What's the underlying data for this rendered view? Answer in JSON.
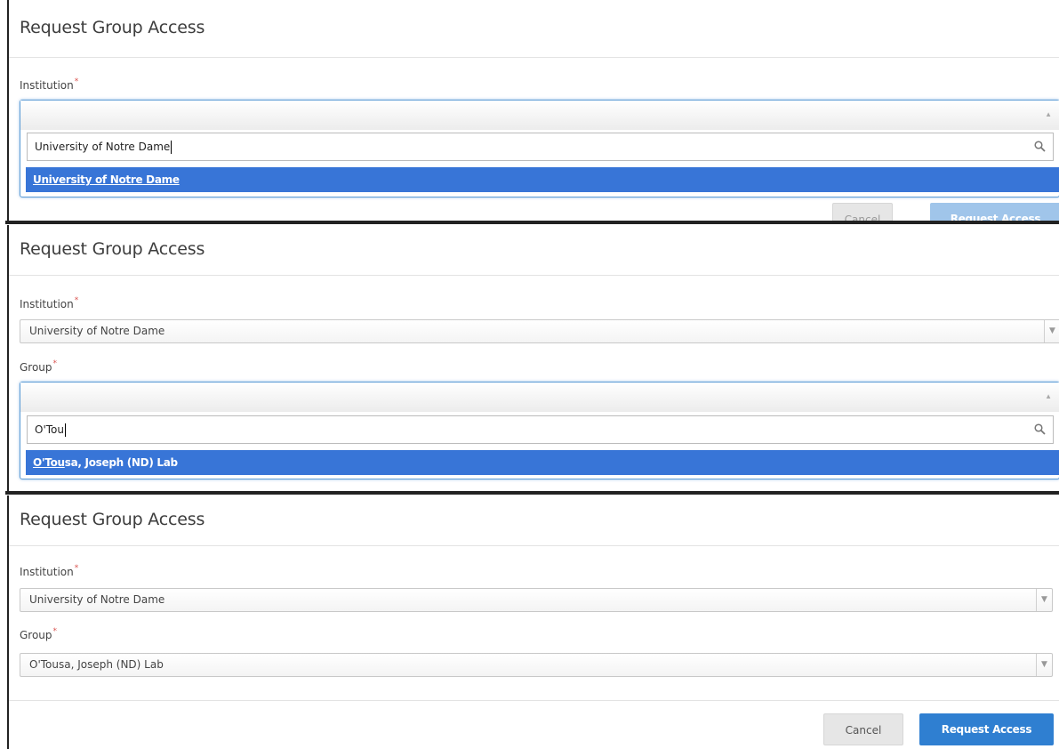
{
  "panels": [
    {
      "title": "Request Group Access",
      "institution_label": "Institution",
      "institution_search": "University of Notre Dame",
      "institution_option": "University of Notre Dame",
      "cancel_label": "Cancel",
      "request_label": "Request Access"
    },
    {
      "title": "Request Group Access",
      "institution_label": "Institution",
      "institution_value": "University of Notre Dame",
      "group_label": "Group",
      "group_search": "O'Tou",
      "group_option_match": "O'Tou",
      "group_option_rest": "sa, Joseph (ND) Lab"
    },
    {
      "title": "Request Group Access",
      "institution_label": "Institution",
      "institution_value": "University of Notre Dame",
      "group_label": "Group",
      "group_value": "O'Tousa, Joseph (ND) Lab",
      "cancel_label": "Cancel",
      "request_label": "Request Access"
    }
  ],
  "required_marker": "*",
  "colors": {
    "option_highlight": "#3875d7",
    "primary_button": "#2f7fd1",
    "required": "#d9534f",
    "focus_border": "#5b9bd5"
  },
  "icons": {
    "search": "search-icon",
    "arrow_down": "chevron-down-icon",
    "arrow_up": "chevron-up-icon"
  }
}
